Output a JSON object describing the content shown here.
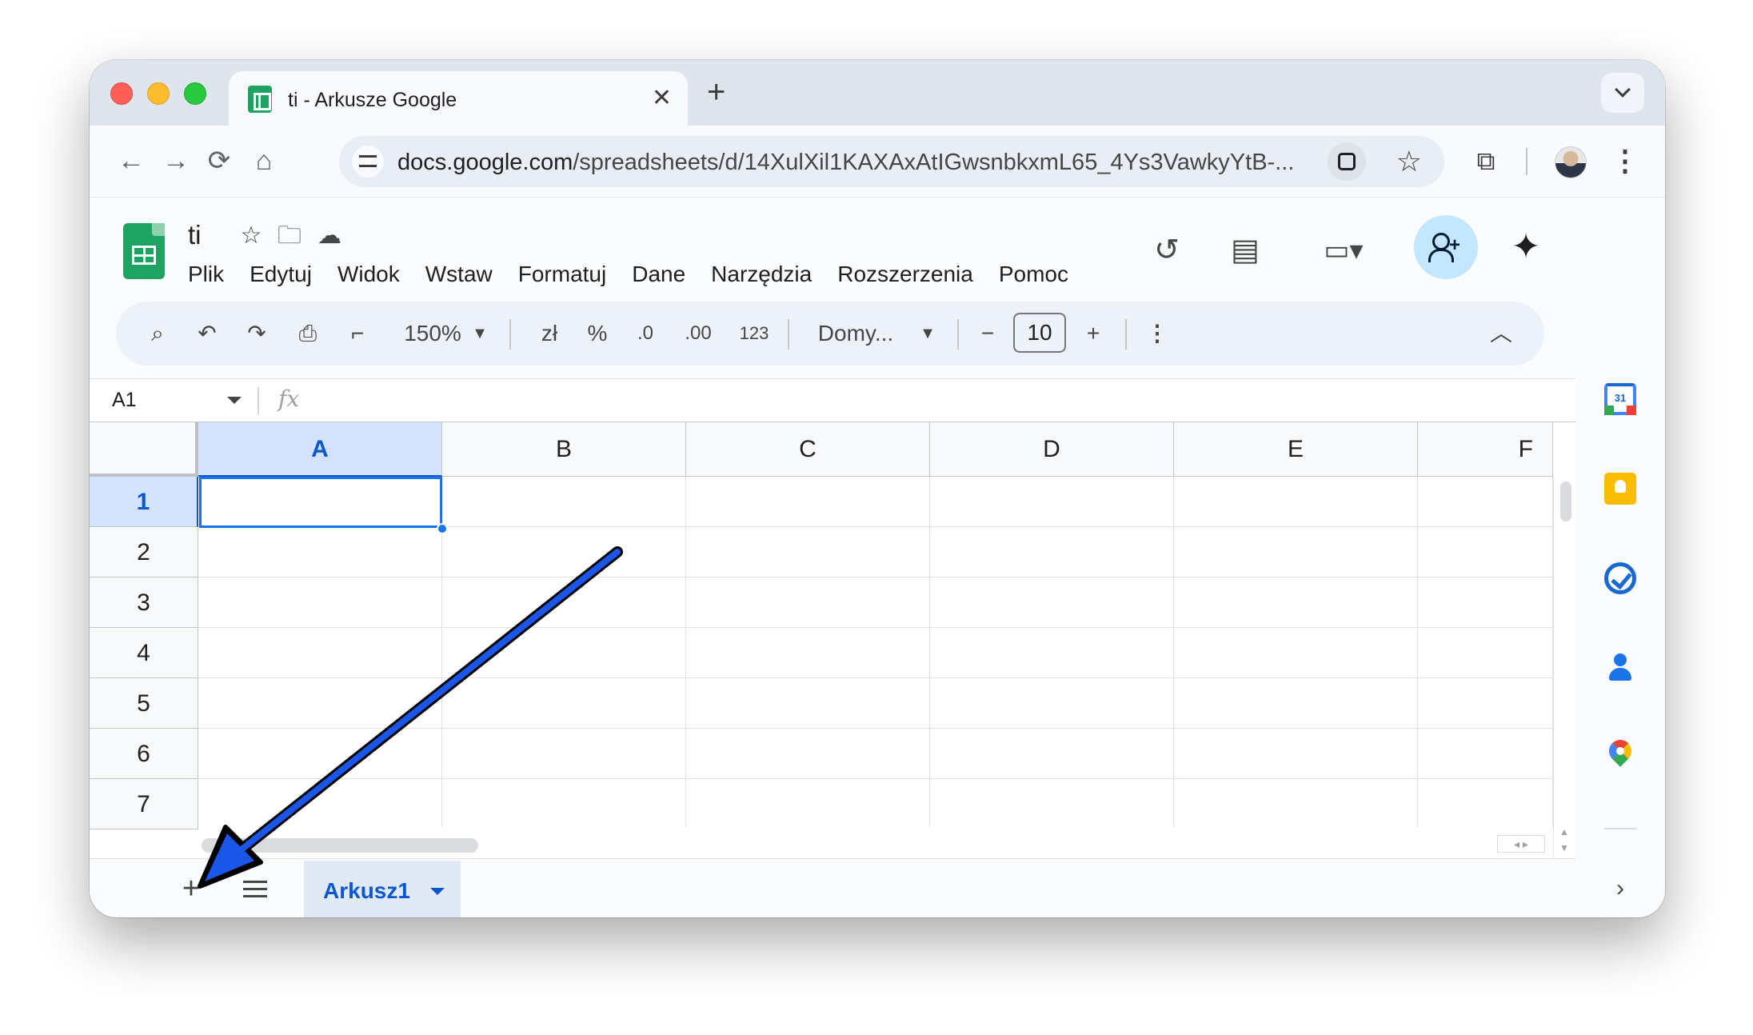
{
  "browser": {
    "tab_title": "ti - Arkusze Google",
    "new_tab_symbol": "+",
    "close_symbol": "✕",
    "url_domain": "docs.google.com",
    "url_path": "/spreadsheets/d/14XulXil1KAXAxAtIGwsnbkxmL65_4Ys3VawkyYtB-..."
  },
  "app": {
    "doc_title": "ti",
    "menu": [
      "Plik",
      "Edytuj",
      "Widok",
      "Wstaw",
      "Formatuj",
      "Dane",
      "Narzędzia",
      "Rozszerzenia",
      "Pomoc"
    ]
  },
  "toolbar": {
    "zoom": "150%",
    "currency": "zł",
    "percent": "%",
    "decrease_decimal": ".0",
    "increase_decimal": ".00",
    "number_format": "123",
    "font": "Domy...",
    "font_size": "10",
    "minus": "−",
    "plus": "+"
  },
  "formula_bar": {
    "name_box": "A1",
    "fx": "fx"
  },
  "grid": {
    "columns": [
      "A",
      "B",
      "C",
      "D",
      "E",
      "F"
    ],
    "rows": [
      "1",
      "2",
      "3",
      "4",
      "5",
      "6",
      "7"
    ],
    "selected_cell": "A1"
  },
  "sheets": {
    "add_symbol": "+",
    "tabs": [
      {
        "label": "Arkusz1",
        "active": true
      }
    ]
  },
  "side_panel": {
    "calendar_day": "31"
  },
  "colors": {
    "accent": "#0b57d0",
    "selection": "#1a73e8",
    "sheets_green": "#1ea362",
    "annotation_arrow": "#1a56e8"
  }
}
